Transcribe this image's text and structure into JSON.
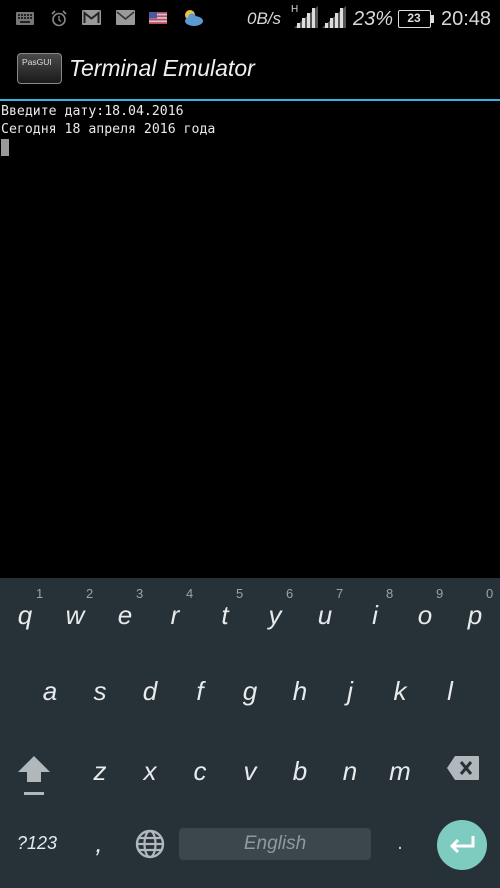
{
  "status_bar": {
    "left_icons": [
      "keyboard-icon",
      "alarm-icon",
      "gmail-icon",
      "email-icon",
      "us-flag-icon",
      "weather-icon"
    ],
    "network_speed": "0B/s",
    "network_type": "H",
    "battery_percent_text": "23%",
    "battery_level": "23",
    "time": "20:48"
  },
  "action_bar": {
    "app_icon_label": "PasGUI",
    "title": "Terminal Emulator",
    "divider_color": "#33b5e5"
  },
  "terminal": {
    "lines": [
      "Введите дату:18.04.2016",
      "Сегодня 18 апреля 2016 года"
    ]
  },
  "keyboard": {
    "background": "#263238",
    "row1": [
      {
        "key": "q",
        "hint": "1"
      },
      {
        "key": "w",
        "hint": "2"
      },
      {
        "key": "e",
        "hint": "3"
      },
      {
        "key": "r",
        "hint": "4"
      },
      {
        "key": "t",
        "hint": "5"
      },
      {
        "key": "y",
        "hint": "6"
      },
      {
        "key": "u",
        "hint": "7"
      },
      {
        "key": "i",
        "hint": "8"
      },
      {
        "key": "o",
        "hint": "9"
      },
      {
        "key": "p",
        "hint": "0"
      }
    ],
    "row2": [
      "a",
      "s",
      "d",
      "f",
      "g",
      "h",
      "j",
      "k",
      "l"
    ],
    "row3": [
      "z",
      "x",
      "c",
      "v",
      "b",
      "n",
      "m"
    ],
    "symbols_label": "?123",
    "comma_label": ",",
    "space_label": "English",
    "period_label": ".",
    "enter_color": "#7ecbc0"
  }
}
